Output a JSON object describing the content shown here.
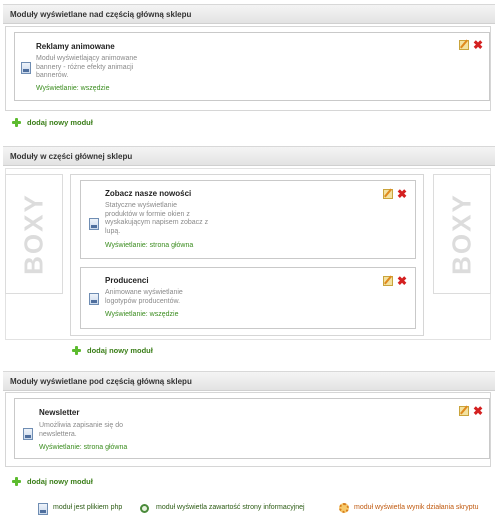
{
  "sections": {
    "above": {
      "title": "Moduły wyświetlane nad częścią główną sklepu",
      "modules": [
        {
          "title": "Reklamy animowane",
          "desc_lines": [
            "Moduł wyświetlający animowane",
            "bannery - różne efekty animacji",
            "bannerów."
          ],
          "display": "Wyświetlanie: wszędzie"
        }
      ],
      "add_label": "dodaj nowy moduł"
    },
    "main": {
      "title": "Moduły w części głównej sklepu",
      "boxy_label": "BOXY",
      "modules": [
        {
          "title": "Zobacz nasze nowości",
          "desc_lines": [
            "Statyczne wyświetlanie",
            "produktów w formie okien z",
            "wyskakującym napisem zobacz z",
            "lupą."
          ],
          "display": "Wyświetlanie: strona główna"
        },
        {
          "title": "Producenci",
          "desc_lines": [
            "Animowane wyświetlanie",
            "logotypów producentów."
          ],
          "display": "Wyświetlanie: wszędzie"
        }
      ],
      "add_label": "dodaj nowy moduł"
    },
    "below": {
      "title": "Moduły wyświetlane pod częścią główną sklepu",
      "modules": [
        {
          "title": "Newsletter",
          "desc_lines": [
            "Umożliwia zapisanie się do",
            "newslettera."
          ],
          "display": "Wyświetlanie: strona główna"
        }
      ],
      "add_label": "dodaj nowy moduł"
    }
  },
  "legend": {
    "php": "moduł jest plikiem php",
    "info": "moduł wyświetla zawartość strony informacyjnej",
    "script": "moduł wyświetla wynik działania skryptu"
  },
  "icons": {
    "module": "php-file-icon",
    "edit": "edit-pencil-icon",
    "delete": "delete-x-icon",
    "add": "green-plus-icon",
    "info": "info-page-icon",
    "script": "gear-script-icon"
  },
  "colors": {
    "display_text": "#3a8c1e",
    "add_text": "#3a7e18",
    "delete": "#d42020"
  }
}
